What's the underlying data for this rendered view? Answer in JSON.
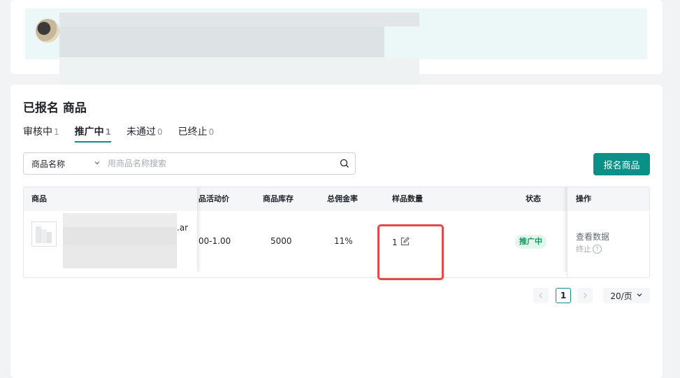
{
  "section": {
    "title": "已报名 商品"
  },
  "tabs": [
    {
      "label": "审核中",
      "count": "1"
    },
    {
      "label": "推广中",
      "count": "1"
    },
    {
      "label": "未通过",
      "count": "0"
    },
    {
      "label": "已终止",
      "count": "0"
    }
  ],
  "search": {
    "field_select": "商品名称",
    "placeholder": "用商品名称搜索"
  },
  "primary_button": "报名商品",
  "table": {
    "headers": [
      "商品",
      "品活动价",
      "商品库存",
      "总佣金率",
      "样品数量",
      "状态",
      "操作"
    ],
    "rows": [
      {
        "product_name_fragment": ".ar",
        "price": "00-1.00",
        "stock": "5000",
        "commission": "11%",
        "sample_qty": "1",
        "status": "推广中",
        "action_view": "查看数据",
        "action_stop": "终止"
      }
    ]
  },
  "pagination": {
    "current_page": "1",
    "page_size": "20/页"
  },
  "colors": {
    "brand": "#0a9187",
    "status_green": "#0d9b5c",
    "highlight_red": "#e04a4a"
  }
}
